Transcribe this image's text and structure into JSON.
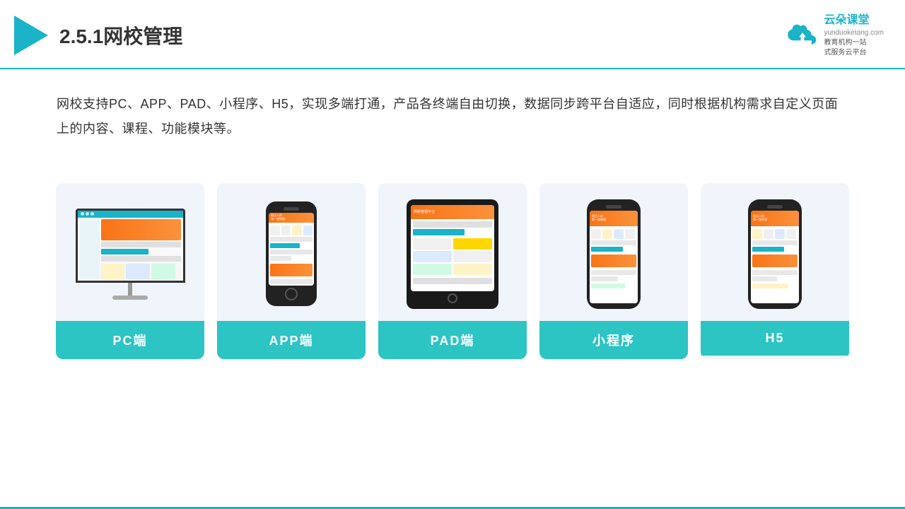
{
  "header": {
    "title": "2.5.1网校管理",
    "brand": {
      "name": "云朵课堂",
      "url": "yunduoketang.com",
      "tagline1": "教育机构一站",
      "tagline2": "式服务云平台"
    }
  },
  "description": "网校支持PC、APP、PAD、小程序、H5，实现多端打通，产品各终端自由切换，数据同步跨平台自适应，同时根据机构需求自定义页面上的内容、课程、功能模块等。",
  "cards": [
    {
      "id": "pc",
      "label": "PC端"
    },
    {
      "id": "app",
      "label": "APP端"
    },
    {
      "id": "pad",
      "label": "PAD端"
    },
    {
      "id": "miniprogram",
      "label": "小程序"
    },
    {
      "id": "h5",
      "label": "H5"
    }
  ],
  "colors": {
    "teal": "#1ab3c8",
    "teal_light": "#2dc4c4",
    "bg_card": "#f0f4fb",
    "orange": "#f97316"
  }
}
